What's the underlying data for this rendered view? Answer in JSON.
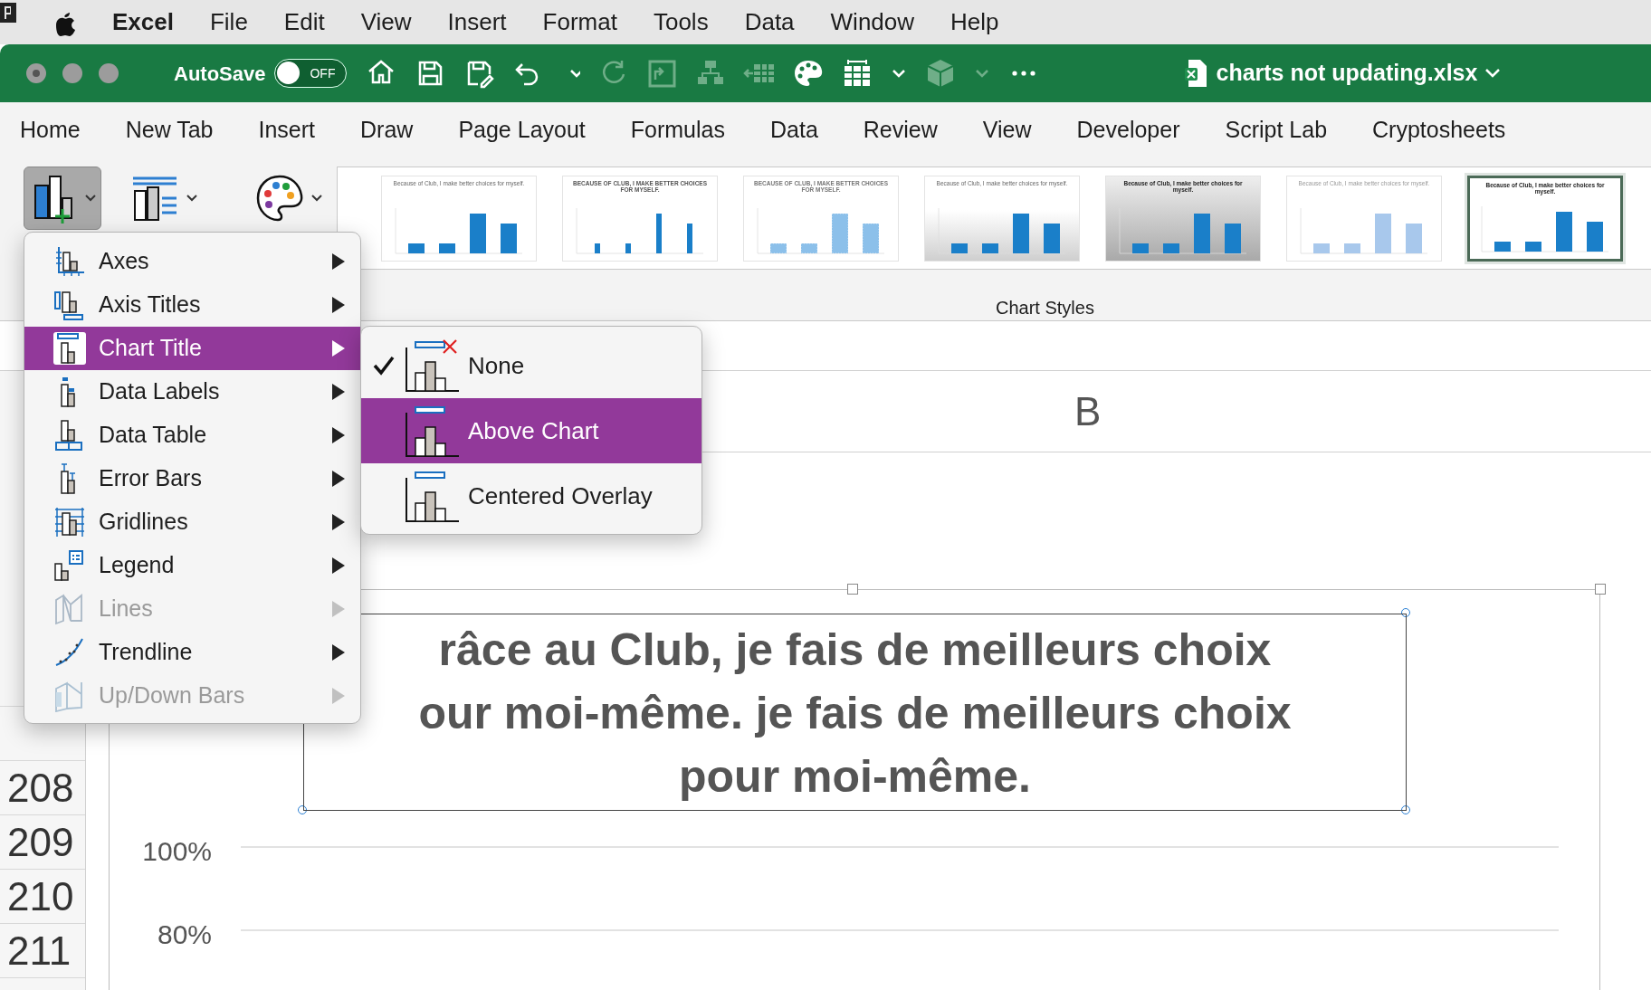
{
  "menu_bar": {
    "app": "Excel",
    "items": [
      "File",
      "Edit",
      "View",
      "Insert",
      "Format",
      "Tools",
      "Data",
      "Window",
      "Help"
    ]
  },
  "toolbar": {
    "autosave_label": "AutoSave",
    "autosave": {
      "on": false,
      "label": "OFF"
    },
    "filename": "charts not updating.xlsx"
  },
  "ribbon_tabs": [
    "Home",
    "New Tab",
    "Insert",
    "Draw",
    "Page Layout",
    "Formulas",
    "Data",
    "Review",
    "View",
    "Developer",
    "Script Lab",
    "Cryptosheets"
  ],
  "ribbon": {
    "add_chart_element_open": true,
    "gallery_label": "Chart Styles",
    "chart_styles": [
      {
        "kind": "plain",
        "title": "Because of Club, I make better choices for myself.",
        "selected": false
      },
      {
        "kind": "caps",
        "title": "BECAUSE OF CLUB, I MAKE BETTER CHOICES FOR MYSELF.",
        "selected": false
      },
      {
        "kind": "striped",
        "title": "BECAUSE OF CLUB, I MAKE BETTER CHOICES FOR MYSELF.",
        "selected": false
      },
      {
        "kind": "shaded",
        "title": "Because of Club, I make better choices for myself.",
        "selected": false
      },
      {
        "kind": "dark",
        "title": "Because of Club, I make better choices for myself.",
        "selected": false
      },
      {
        "kind": "light",
        "title": "Because of Club, I make better choices for myself.",
        "selected": false
      },
      {
        "kind": "bold",
        "title": "Because of Club, I make better choices for myself.",
        "selected": true
      }
    ]
  },
  "sheet": {
    "column_header": "B",
    "row_numbers": [
      "208",
      "209",
      "210",
      "211"
    ]
  },
  "chart": {
    "title_lines": [
      "râce au Club, je fais de meilleurs choix",
      "our moi-même. je fais de meilleurs choix",
      "pour moi-même."
    ],
    "y_labels": [
      "100%",
      "80%"
    ]
  },
  "chart_element_menu": {
    "items": [
      {
        "label": "Axes",
        "disabled": false,
        "selected": false
      },
      {
        "label": "Axis Titles",
        "disabled": false,
        "selected": false
      },
      {
        "label": "Chart Title",
        "disabled": false,
        "selected": true
      },
      {
        "label": "Data Labels",
        "disabled": false,
        "selected": false
      },
      {
        "label": "Data Table",
        "disabled": false,
        "selected": false
      },
      {
        "label": "Error Bars",
        "disabled": false,
        "selected": false
      },
      {
        "label": "Gridlines",
        "disabled": false,
        "selected": false
      },
      {
        "label": "Legend",
        "disabled": false,
        "selected": false
      },
      {
        "label": "Lines",
        "disabled": true,
        "selected": false
      },
      {
        "label": "Trendline",
        "disabled": false,
        "selected": false
      },
      {
        "label": "Up/Down Bars",
        "disabled": true,
        "selected": false
      }
    ]
  },
  "chart_title_submenu": {
    "items": [
      {
        "label": "None",
        "checked": true,
        "selected": false
      },
      {
        "label": "Above Chart",
        "checked": false,
        "selected": true
      },
      {
        "label": "Centered Overlay",
        "checked": false,
        "selected": false
      }
    ]
  }
}
